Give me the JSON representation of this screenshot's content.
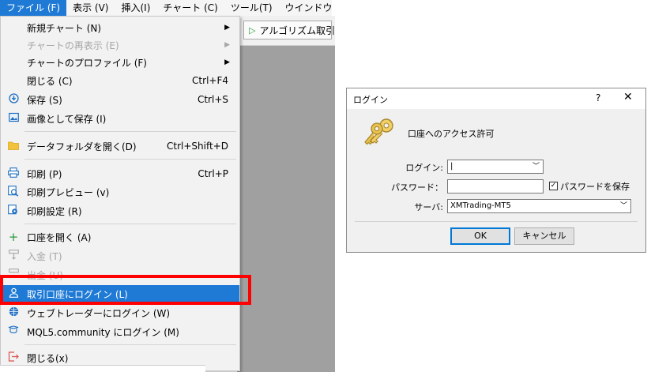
{
  "menubar": {
    "items": [
      "ファイル (F)",
      "表示 (V)",
      "挿入(I)",
      "チャート (C)",
      "ツール(T)",
      "ウインドウ"
    ]
  },
  "toolbar": {
    "algo_trading": "アルゴリズム取引"
  },
  "file_menu": {
    "items": [
      {
        "label": "新規チャート (N)",
        "submenu": true,
        "shortcut": "",
        "icon": "",
        "disabled": false
      },
      {
        "label": "チャートの再表示 (E)",
        "submenu": true,
        "shortcut": "",
        "icon": "",
        "disabled": true
      },
      {
        "label": "チャートのプロファイル (F)",
        "submenu": true,
        "shortcut": "",
        "icon": "",
        "disabled": false
      },
      {
        "label": "閉じる (C)",
        "submenu": false,
        "shortcut": "Ctrl+F4",
        "icon": "",
        "disabled": false
      },
      {
        "label": "保存 (S)",
        "submenu": false,
        "shortcut": "Ctrl+S",
        "icon": "save-icon",
        "disabled": false
      },
      {
        "label": "画像として保存 (I)",
        "submenu": false,
        "shortcut": "",
        "icon": "image-icon",
        "disabled": false
      },
      {
        "label": "データフォルダを開く(D)",
        "submenu": false,
        "shortcut": "Ctrl+Shift+D",
        "icon": "folder-icon",
        "disabled": false
      },
      {
        "label": "印刷 (P)",
        "submenu": false,
        "shortcut": "Ctrl+P",
        "icon": "printer-icon",
        "disabled": false
      },
      {
        "label": "印刷プレビュー (v)",
        "submenu": false,
        "shortcut": "",
        "icon": "print-preview-icon",
        "disabled": false
      },
      {
        "label": "印刷設定 (R)",
        "submenu": false,
        "shortcut": "",
        "icon": "print-settings-icon",
        "disabled": false
      },
      {
        "label": "口座を開く (A)",
        "submenu": false,
        "shortcut": "",
        "icon": "plus-icon",
        "disabled": false
      },
      {
        "label": "入金 (T)",
        "submenu": false,
        "shortcut": "",
        "icon": "deposit-icon",
        "disabled": true
      },
      {
        "label": "出金 (U)",
        "submenu": false,
        "shortcut": "",
        "icon": "withdraw-icon",
        "disabled": true
      },
      {
        "label": "取引口座にログイン (L)",
        "submenu": false,
        "shortcut": "",
        "icon": "user-icon",
        "disabled": false,
        "highlighted": true
      },
      {
        "label": "ウェブトレーダーにログイン (W)",
        "submenu": false,
        "shortcut": "",
        "icon": "globe-icon",
        "disabled": false
      },
      {
        "label": "MQL5.community にログイン (M)",
        "submenu": false,
        "shortcut": "",
        "icon": "mql5-icon",
        "disabled": false
      },
      {
        "label": "閉じる(x)",
        "submenu": false,
        "shortcut": "",
        "icon": "exit-icon",
        "disabled": false
      }
    ]
  },
  "login_dialog": {
    "title": "ログイン",
    "help": "?",
    "close": "✕",
    "heading": "口座へのアクセス許可",
    "login_label": "ログイン:",
    "login_value": "|",
    "password_label": "パスワード：",
    "save_password_label": "パスワードを保存",
    "save_password_checked": true,
    "server_label": "サーバ:",
    "server_value": "XMTrading-MT5",
    "ok_label": "OK",
    "cancel_label": "キャンセル"
  },
  "colors": {
    "highlight": "#1f7ad6",
    "annotation_red": "#ff0000"
  }
}
